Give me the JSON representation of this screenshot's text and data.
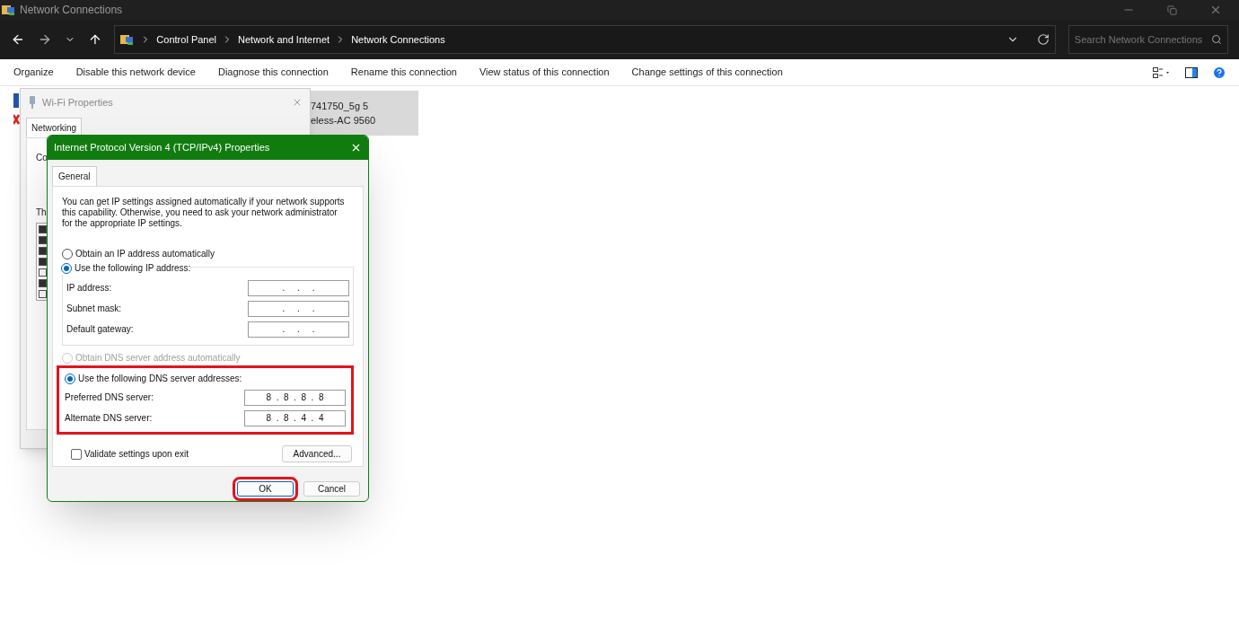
{
  "window": {
    "title": "Network Connections"
  },
  "address_bar": {
    "crumbs": [
      "Control Panel",
      "Network and Internet",
      "Network Connections"
    ]
  },
  "search": {
    "placeholder": "Search Network Connections"
  },
  "command_bar": {
    "items": [
      "Organize",
      "Disable this network device",
      "Diagnose this connection",
      "Rename this connection",
      "View status of this connection",
      "Change settings of this connection"
    ]
  },
  "connection": {
    "selected": true,
    "name": "741750_5g 5",
    "device": "eless-AC 9560"
  },
  "wifi_dialog": {
    "title": "Wi-Fi Properties",
    "tabs": [
      {
        "label": "Networking",
        "selected": true
      }
    ],
    "label_1": "Co",
    "label_2": "Th",
    "components": [
      {
        "checked": true
      },
      {
        "checked": true
      },
      {
        "checked": true
      },
      {
        "checked": true
      },
      {
        "checked": false
      },
      {
        "checked": true
      },
      {
        "checked": false
      }
    ]
  },
  "ipv4_dialog": {
    "title": "Internet Protocol Version 4 (TCP/IPv4) Properties",
    "tabs": [
      {
        "label": "General",
        "selected": true
      }
    ],
    "description": "You can get IP settings assigned automatically if your network supports this capability. Otherwise, you need to ask your network administrator for the appropriate IP settings.",
    "ip_options": [
      {
        "label": "Obtain an IP address automatically",
        "selected": false,
        "disabled": false
      },
      {
        "label": "Use the following IP address:",
        "selected": true,
        "disabled": false
      }
    ],
    "ip_fields": [
      {
        "label": "IP address:",
        "value": ".     .     ."
      },
      {
        "label": "Subnet mask:",
        "value": ".     .     ."
      },
      {
        "label": "Default gateway:",
        "value": ".     .     ."
      }
    ],
    "dns_options": [
      {
        "label": "Obtain DNS server address automatically",
        "selected": false,
        "disabled": true
      },
      {
        "label": "Use the following DNS server addresses:",
        "selected": true,
        "disabled": false
      }
    ],
    "dns_highlighted": true,
    "dns_fields": [
      {
        "label": "Preferred DNS server:",
        "value": "8  .  8  .  8  .  8"
      },
      {
        "label": "Alternate DNS server:",
        "value": "8  .  8  .  4  .  4"
      }
    ],
    "validate": {
      "label": "Validate settings upon exit",
      "checked": false
    },
    "advanced": "Advanced...",
    "buttons": [
      {
        "label": "OK",
        "highlighted": true
      },
      {
        "label": "Cancel",
        "highlighted": false
      }
    ]
  }
}
